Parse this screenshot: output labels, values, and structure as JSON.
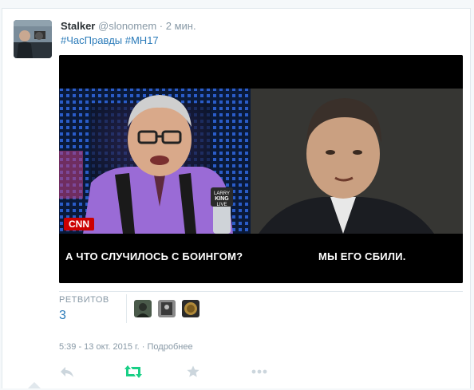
{
  "tweet": {
    "name": "Stalker",
    "handle": "@slonomem",
    "separator": "·",
    "time": "2 мин.",
    "hashtags": [
      "#ЧасПравды",
      "#MH17"
    ]
  },
  "media": {
    "caption_left": "А ЧТО СЛУЧИЛОСЬ С БОИНГОМ?",
    "caption_right": "МЫ ЕГО СБИЛИ.",
    "cnn_logo": "CNN",
    "mic_text_1": "LARRY",
    "mic_text_2": "KING",
    "mic_text_3": "LIVE"
  },
  "stats": {
    "retweets_label": "РЕТВИТОВ",
    "retweets_count": "3",
    "retweeter_avatars": [
      "avatar-1",
      "avatar-2",
      "avatar-3"
    ]
  },
  "footer": {
    "timestamp": "5:39 - 13 окт. 2015 г.",
    "separator": "·",
    "details_link": "Подробнее"
  },
  "actions": {
    "reply_icon": "reply-icon",
    "retweet_icon": "retweet-icon",
    "favorite_icon": "star-icon",
    "more_icon": "more-icon"
  },
  "colors": {
    "link": "#2b7bb9",
    "muted": "#8899a6",
    "retweet_green": "#19cf86",
    "action_gray": "#ccd6dd"
  }
}
